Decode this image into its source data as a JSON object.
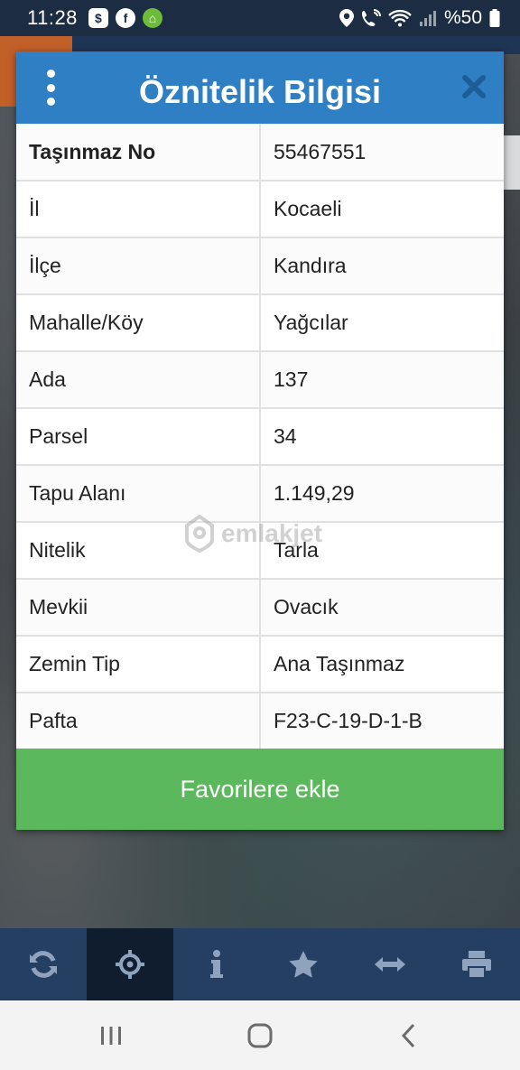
{
  "status": {
    "time": "11:28",
    "battery": "%50",
    "apps": [
      "$",
      "f",
      "⌂"
    ]
  },
  "modal": {
    "title": "Öznitelik Bilgisi",
    "rows": [
      {
        "key": "Taşınmaz No",
        "value": "55467551"
      },
      {
        "key": "İl",
        "value": "Kocaeli"
      },
      {
        "key": "İlçe",
        "value": "Kandıra"
      },
      {
        "key": "Mahalle/Köy",
        "value": "Yağcılar"
      },
      {
        "key": "Ada",
        "value": "137"
      },
      {
        "key": "Parsel",
        "value": "34"
      },
      {
        "key": "Tapu Alanı",
        "value": "1.149,29"
      },
      {
        "key": "Nitelik",
        "value": "Tarla"
      },
      {
        "key": "Mevkii",
        "value": "Ovacık"
      },
      {
        "key": "Zemin Tip",
        "value": "Ana Taşınmaz"
      },
      {
        "key": "Pafta",
        "value": "F23-C-19-D-1-B"
      }
    ],
    "favorite_label": "Favorilere ekle"
  },
  "watermark": {
    "text": "emlakjet"
  },
  "toolbar": {
    "items": [
      "refresh-icon",
      "locate-icon",
      "info-icon",
      "star-icon",
      "measure-icon",
      "print-icon"
    ],
    "active_index": 1
  },
  "colors": {
    "header": "#2e7fc3",
    "favorite": "#5cb85c",
    "toolbar": "#253f63",
    "toolbar_active": "#0f1d2f"
  }
}
